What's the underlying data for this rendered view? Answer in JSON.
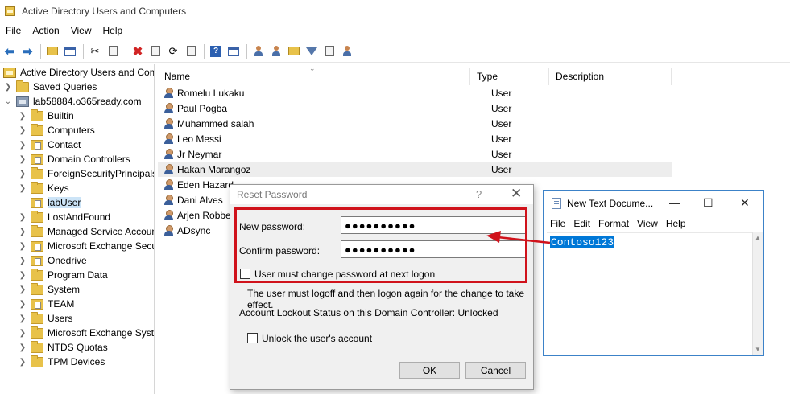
{
  "window": {
    "title": "Active Directory Users and Computers"
  },
  "menu": [
    "File",
    "Action",
    "View",
    "Help"
  ],
  "toolbar": {
    "icons": [
      "back-arrow-icon",
      "forward-arrow-icon",
      "folder-up-icon",
      "details-view-icon",
      "cut-icon",
      "copy-icon",
      "delete-icon",
      "properties-icon",
      "refresh-icon",
      "export-icon",
      "help-icon",
      "console-icon",
      "add-user-icon",
      "add-group-icon",
      "add-ou-icon",
      "filter-icon",
      "find-icon",
      "add-to-group-icon"
    ]
  },
  "tree": {
    "root": "Active Directory Users and Com",
    "saved_queries": "Saved Queries",
    "domain": "lab58884.o365ready.com",
    "items": [
      "Builtin",
      "Computers",
      "Contact",
      "Domain Controllers",
      "ForeignSecurityPrincipals",
      "Keys",
      "labUser",
      "LostAndFound",
      "Managed Service Accoun",
      "Microsoft Exchange Secu",
      "Onedrive",
      "Program Data",
      "System",
      "TEAM",
      "Users",
      "Microsoft Exchange Syste",
      "NTDS Quotas",
      "TPM Devices"
    ],
    "selected": "labUser"
  },
  "list": {
    "columns": [
      "Name",
      "Type",
      "Description"
    ],
    "rows": [
      {
        "name": "Romelu Lukaku",
        "type": "User"
      },
      {
        "name": "Paul Pogba",
        "type": "User"
      },
      {
        "name": "Muhammed salah",
        "type": "User"
      },
      {
        "name": "Leo Messi",
        "type": "User"
      },
      {
        "name": "Jr Neymar",
        "type": "User"
      },
      {
        "name": "Hakan Marangoz",
        "type": "User"
      },
      {
        "name": "Eden Hazard",
        "type": ""
      },
      {
        "name": "Dani Alves",
        "type": ""
      },
      {
        "name": "Arjen Robbe",
        "type": ""
      },
      {
        "name": "ADsync",
        "type": ""
      }
    ]
  },
  "dialog": {
    "title": "Reset Password",
    "help_glyph": "?",
    "close_glyph": "✕",
    "new_password_label": "New password:",
    "new_password_value": "●●●●●●●●●●",
    "confirm_password_label": "Confirm password:",
    "confirm_password_value": "●●●●●●●●●●",
    "must_change_label": "User must change password at next logon",
    "info": "The user must logoff and then logon again for the change to take effect.",
    "lockout_status": "Account Lockout Status on this Domain Controller: Unlocked",
    "unlock_label": "Unlock the user's account",
    "ok": "OK",
    "cancel": "Cancel"
  },
  "notepad": {
    "title": "New Text Docume...",
    "minimize_glyph": "—",
    "maximize_glyph": "☐",
    "close_glyph": "✕",
    "menu": [
      "File",
      "Edit",
      "Format",
      "View",
      "Help"
    ],
    "text": "Contoso123"
  },
  "colors": {
    "annotation": "#d0121b",
    "selection": "#0078d7",
    "tree_selected": "#cce4f7"
  }
}
